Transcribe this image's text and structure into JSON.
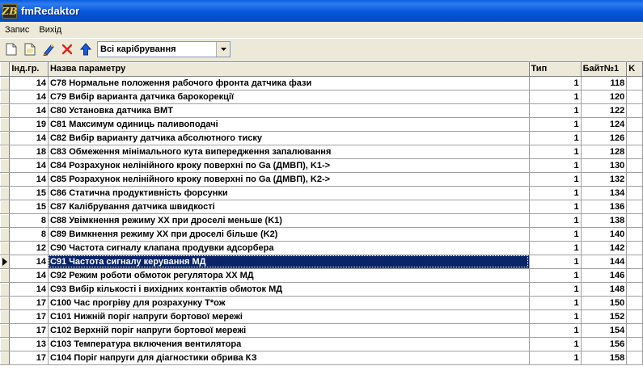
{
  "window": {
    "title": "fmRedaktor",
    "logo_text": "ZB"
  },
  "menu": {
    "items": [
      "Запис",
      "Вихід"
    ]
  },
  "toolbar": {
    "filter_value": "Всі карібрування"
  },
  "table": {
    "columns": [
      "Інд.гр.",
      "Назва параметру",
      "Тип",
      "Байт№1",
      "K"
    ],
    "rows": [
      {
        "group": "14",
        "name": "C78 Нормальне положення рабочого фронта датчика фази",
        "type": "1",
        "byte": "118"
      },
      {
        "group": "14",
        "name": "C79 Вибір варианта датчика барокорекції",
        "type": "1",
        "byte": "120"
      },
      {
        "group": "14",
        "name": "C80 Установка датчика ВМТ",
        "type": "1",
        "byte": "122"
      },
      {
        "group": "19",
        "name": "C81 Максимум одиниць паливоподачі",
        "type": "1",
        "byte": "124"
      },
      {
        "group": "14",
        "name": "C82 Вибір варианту датчика абсолютного тиску",
        "type": "1",
        "byte": "126"
      },
      {
        "group": "18",
        "name": "C83 Обмеження мінімального кута випередження запалювання",
        "type": "1",
        "byte": "128"
      },
      {
        "group": "14",
        "name": "C84 Розрахунок нелінійного кроку поверхні по Ga (ДМВП), K1->",
        "type": "1",
        "byte": "130"
      },
      {
        "group": "14",
        "name": "C85 Розрахунок нелінійного кроку поверхні по Ga (ДМВП), K2->",
        "type": "1",
        "byte": "132"
      },
      {
        "group": "15",
        "name": "C86 Статична продуктивність форсунки",
        "type": "1",
        "byte": "134"
      },
      {
        "group": "15",
        "name": "C87 Калібрування датчика швидкості",
        "type": "1",
        "byte": "136"
      },
      {
        "group": "8",
        "name": "C88 Увімкнення режиму ХХ при дроселі меньше (K1)",
        "type": "1",
        "byte": "138"
      },
      {
        "group": "8",
        "name": "C89 Вимкнення режиму ХХ при дроселі більше (K2)",
        "type": "1",
        "byte": "140"
      },
      {
        "group": "12",
        "name": "C90 Частота сигналу клапана продувки адсорбера",
        "type": "1",
        "byte": "142"
      },
      {
        "group": "14",
        "name": "C91 Частота сигналу керування МД",
        "type": "1",
        "byte": "144"
      },
      {
        "group": "14",
        "name": "C92 Режим роботи обмоток регулятора ХХ МД",
        "type": "1",
        "byte": "146"
      },
      {
        "group": "14",
        "name": "C93 Вибір кількості і вихідних контактів обмоток МД",
        "type": "1",
        "byte": "148"
      },
      {
        "group": "17",
        "name": "C100 Час прогріву для розрахунку T*ож",
        "type": "1",
        "byte": "150"
      },
      {
        "group": "17",
        "name": "C101 Нижній поріг напруги бортової мережі",
        "type": "1",
        "byte": "152"
      },
      {
        "group": "17",
        "name": "C102 Верхній поріг напруги бортової мережі",
        "type": "1",
        "byte": "154"
      },
      {
        "group": "13",
        "name": "C103 Температура включения вентилятора",
        "type": "1",
        "byte": "156"
      },
      {
        "group": "17",
        "name": "C104 Поріг напруги для діагностики обрива КЗ",
        "type": "1",
        "byte": "158"
      }
    ]
  }
}
